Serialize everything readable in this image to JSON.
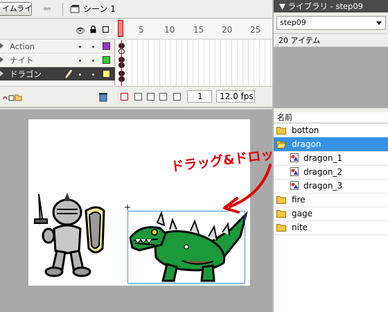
{
  "toolbar": {
    "timeline_button": "イムライン",
    "scene_label": "シーン 1"
  },
  "timeline": {
    "layers": [
      {
        "name": "Action",
        "color": "#9933cc",
        "selected": false
      },
      {
        "name": "ナイト",
        "color": "#33cc33",
        "selected": false
      },
      {
        "name": "ドラゴン",
        "color": "#ffff66",
        "selected": true
      }
    ],
    "frame_numbers": [
      "5",
      "10",
      "15",
      "20",
      "25"
    ],
    "current_frame": "1",
    "fps": "12.0 fps"
  },
  "stage": {
    "annotation": "ドラッグ&ドロップ",
    "annotation_color": "#e00000"
  },
  "library": {
    "title": "ライブラリ - step09",
    "selector": "step09",
    "item_count": "20 アイテム",
    "column_header": "名前",
    "items": [
      {
        "label": "botton",
        "kind": "folder",
        "selected": false
      },
      {
        "label": "dragon",
        "kind": "folder-open",
        "selected": true
      },
      {
        "label": "dragon_1",
        "kind": "graphic",
        "selected": false
      },
      {
        "label": "dragon_2",
        "kind": "graphic",
        "selected": false
      },
      {
        "label": "dragon_3",
        "kind": "graphic",
        "selected": false
      },
      {
        "label": "fire",
        "kind": "folder",
        "selected": false
      },
      {
        "label": "gage",
        "kind": "folder",
        "selected": false
      },
      {
        "label": "nite",
        "kind": "folder",
        "selected": false
      }
    ],
    "accent_color": "#3592e6"
  }
}
